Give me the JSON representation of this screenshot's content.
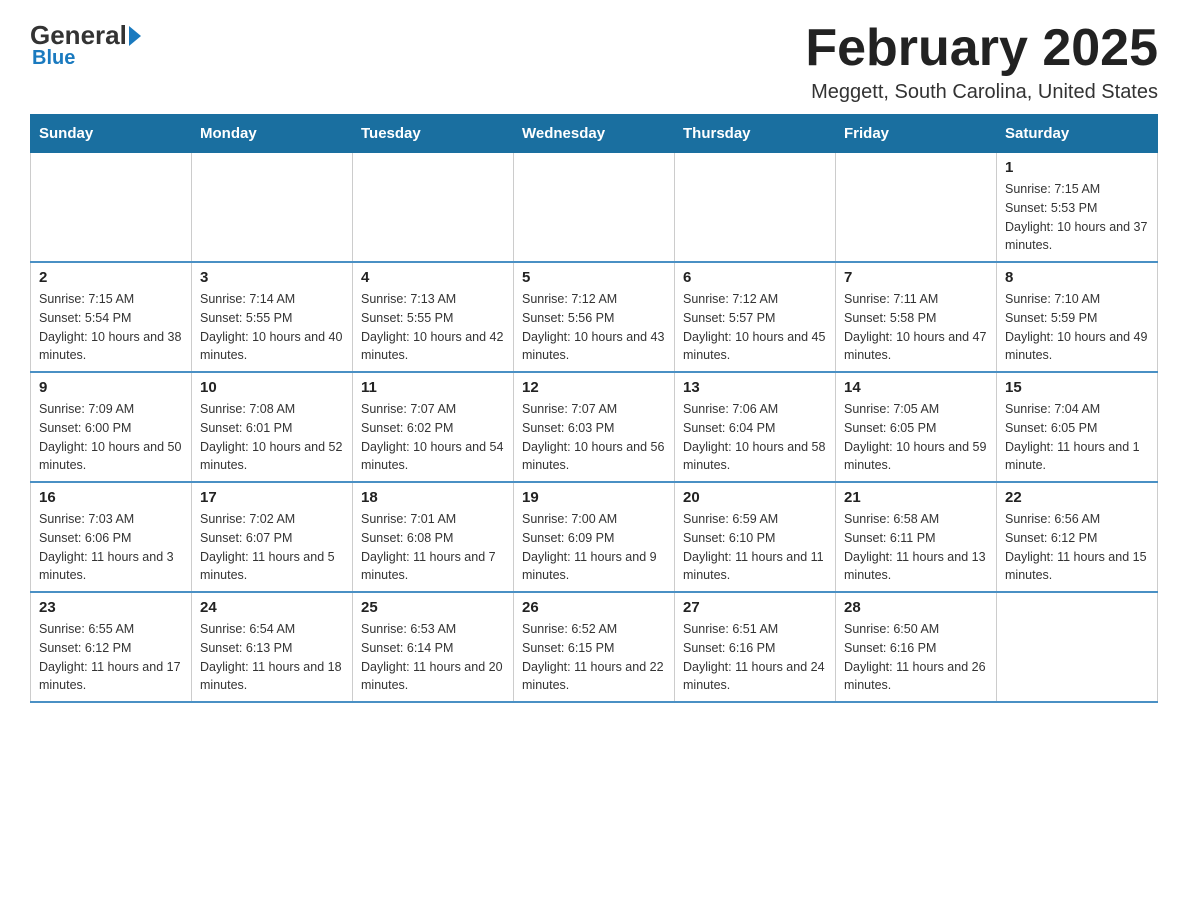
{
  "logo": {
    "general": "General",
    "blue": "Blue"
  },
  "header": {
    "title": "February 2025",
    "location": "Meggett, South Carolina, United States"
  },
  "weekdays": [
    "Sunday",
    "Monday",
    "Tuesday",
    "Wednesday",
    "Thursday",
    "Friday",
    "Saturday"
  ],
  "weeks": [
    [
      {
        "day": "",
        "sunrise": "",
        "sunset": "",
        "daylight": ""
      },
      {
        "day": "",
        "sunrise": "",
        "sunset": "",
        "daylight": ""
      },
      {
        "day": "",
        "sunrise": "",
        "sunset": "",
        "daylight": ""
      },
      {
        "day": "",
        "sunrise": "",
        "sunset": "",
        "daylight": ""
      },
      {
        "day": "",
        "sunrise": "",
        "sunset": "",
        "daylight": ""
      },
      {
        "day": "",
        "sunrise": "",
        "sunset": "",
        "daylight": ""
      },
      {
        "day": "1",
        "sunrise": "Sunrise: 7:15 AM",
        "sunset": "Sunset: 5:53 PM",
        "daylight": "Daylight: 10 hours and 37 minutes."
      }
    ],
    [
      {
        "day": "2",
        "sunrise": "Sunrise: 7:15 AM",
        "sunset": "Sunset: 5:54 PM",
        "daylight": "Daylight: 10 hours and 38 minutes."
      },
      {
        "day": "3",
        "sunrise": "Sunrise: 7:14 AM",
        "sunset": "Sunset: 5:55 PM",
        "daylight": "Daylight: 10 hours and 40 minutes."
      },
      {
        "day": "4",
        "sunrise": "Sunrise: 7:13 AM",
        "sunset": "Sunset: 5:55 PM",
        "daylight": "Daylight: 10 hours and 42 minutes."
      },
      {
        "day": "5",
        "sunrise": "Sunrise: 7:12 AM",
        "sunset": "Sunset: 5:56 PM",
        "daylight": "Daylight: 10 hours and 43 minutes."
      },
      {
        "day": "6",
        "sunrise": "Sunrise: 7:12 AM",
        "sunset": "Sunset: 5:57 PM",
        "daylight": "Daylight: 10 hours and 45 minutes."
      },
      {
        "day": "7",
        "sunrise": "Sunrise: 7:11 AM",
        "sunset": "Sunset: 5:58 PM",
        "daylight": "Daylight: 10 hours and 47 minutes."
      },
      {
        "day": "8",
        "sunrise": "Sunrise: 7:10 AM",
        "sunset": "Sunset: 5:59 PM",
        "daylight": "Daylight: 10 hours and 49 minutes."
      }
    ],
    [
      {
        "day": "9",
        "sunrise": "Sunrise: 7:09 AM",
        "sunset": "Sunset: 6:00 PM",
        "daylight": "Daylight: 10 hours and 50 minutes."
      },
      {
        "day": "10",
        "sunrise": "Sunrise: 7:08 AM",
        "sunset": "Sunset: 6:01 PM",
        "daylight": "Daylight: 10 hours and 52 minutes."
      },
      {
        "day": "11",
        "sunrise": "Sunrise: 7:07 AM",
        "sunset": "Sunset: 6:02 PM",
        "daylight": "Daylight: 10 hours and 54 minutes."
      },
      {
        "day": "12",
        "sunrise": "Sunrise: 7:07 AM",
        "sunset": "Sunset: 6:03 PM",
        "daylight": "Daylight: 10 hours and 56 minutes."
      },
      {
        "day": "13",
        "sunrise": "Sunrise: 7:06 AM",
        "sunset": "Sunset: 6:04 PM",
        "daylight": "Daylight: 10 hours and 58 minutes."
      },
      {
        "day": "14",
        "sunrise": "Sunrise: 7:05 AM",
        "sunset": "Sunset: 6:05 PM",
        "daylight": "Daylight: 10 hours and 59 minutes."
      },
      {
        "day": "15",
        "sunrise": "Sunrise: 7:04 AM",
        "sunset": "Sunset: 6:05 PM",
        "daylight": "Daylight: 11 hours and 1 minute."
      }
    ],
    [
      {
        "day": "16",
        "sunrise": "Sunrise: 7:03 AM",
        "sunset": "Sunset: 6:06 PM",
        "daylight": "Daylight: 11 hours and 3 minutes."
      },
      {
        "day": "17",
        "sunrise": "Sunrise: 7:02 AM",
        "sunset": "Sunset: 6:07 PM",
        "daylight": "Daylight: 11 hours and 5 minutes."
      },
      {
        "day": "18",
        "sunrise": "Sunrise: 7:01 AM",
        "sunset": "Sunset: 6:08 PM",
        "daylight": "Daylight: 11 hours and 7 minutes."
      },
      {
        "day": "19",
        "sunrise": "Sunrise: 7:00 AM",
        "sunset": "Sunset: 6:09 PM",
        "daylight": "Daylight: 11 hours and 9 minutes."
      },
      {
        "day": "20",
        "sunrise": "Sunrise: 6:59 AM",
        "sunset": "Sunset: 6:10 PM",
        "daylight": "Daylight: 11 hours and 11 minutes."
      },
      {
        "day": "21",
        "sunrise": "Sunrise: 6:58 AM",
        "sunset": "Sunset: 6:11 PM",
        "daylight": "Daylight: 11 hours and 13 minutes."
      },
      {
        "day": "22",
        "sunrise": "Sunrise: 6:56 AM",
        "sunset": "Sunset: 6:12 PM",
        "daylight": "Daylight: 11 hours and 15 minutes."
      }
    ],
    [
      {
        "day": "23",
        "sunrise": "Sunrise: 6:55 AM",
        "sunset": "Sunset: 6:12 PM",
        "daylight": "Daylight: 11 hours and 17 minutes."
      },
      {
        "day": "24",
        "sunrise": "Sunrise: 6:54 AM",
        "sunset": "Sunset: 6:13 PM",
        "daylight": "Daylight: 11 hours and 18 minutes."
      },
      {
        "day": "25",
        "sunrise": "Sunrise: 6:53 AM",
        "sunset": "Sunset: 6:14 PM",
        "daylight": "Daylight: 11 hours and 20 minutes."
      },
      {
        "day": "26",
        "sunrise": "Sunrise: 6:52 AM",
        "sunset": "Sunset: 6:15 PM",
        "daylight": "Daylight: 11 hours and 22 minutes."
      },
      {
        "day": "27",
        "sunrise": "Sunrise: 6:51 AM",
        "sunset": "Sunset: 6:16 PM",
        "daylight": "Daylight: 11 hours and 24 minutes."
      },
      {
        "day": "28",
        "sunrise": "Sunrise: 6:50 AM",
        "sunset": "Sunset: 6:16 PM",
        "daylight": "Daylight: 11 hours and 26 minutes."
      },
      {
        "day": "",
        "sunrise": "",
        "sunset": "",
        "daylight": ""
      }
    ]
  ]
}
